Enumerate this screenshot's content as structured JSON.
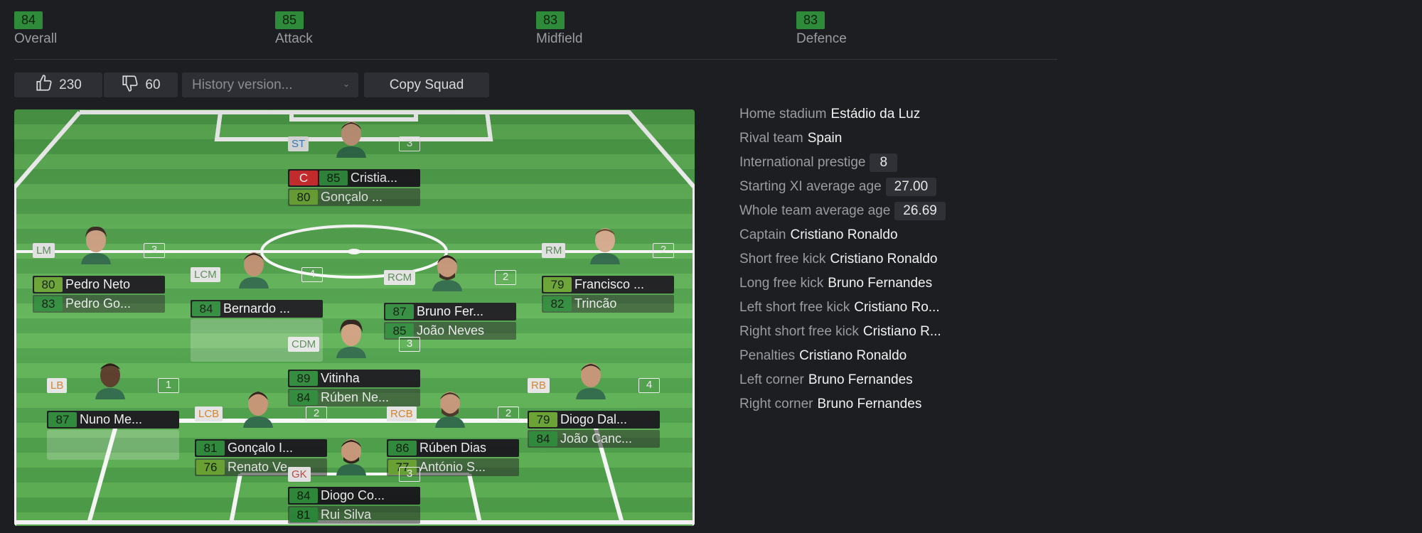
{
  "ratings": [
    {
      "value": "84",
      "label": "Overall"
    },
    {
      "value": "85",
      "label": "Attack"
    },
    {
      "value": "83",
      "label": "Midfield"
    },
    {
      "value": "83",
      "label": "Defence"
    }
  ],
  "toolbar": {
    "likes": "230",
    "dislikes": "60",
    "history_placeholder": "History version...",
    "copy_label": "Copy Squad"
  },
  "colors": {
    "ovr_high": "#2e8b3a",
    "ovr_mid": "#6aa532",
    "captain": "#d22b2b"
  },
  "players": [
    {
      "pos": "ST",
      "pos_group": "att",
      "num": "3",
      "captain": "C",
      "main_ovr": "85",
      "main_name": "Cristia...",
      "sub_ovr": "80",
      "sub_name": "Gonçalo ..."
    },
    {
      "pos": "LM",
      "pos_group": "mid",
      "num": "3",
      "main_ovr": "80",
      "main_name": "Pedro Neto",
      "sub_ovr": "83",
      "sub_name": "Pedro Go..."
    },
    {
      "pos": "LCM",
      "pos_group": "mid",
      "num": "4",
      "main_ovr": "84",
      "main_name": "Bernardo ...",
      "sub_ovr": "",
      "sub_name": ""
    },
    {
      "pos": "RCM",
      "pos_group": "mid",
      "num": "2",
      "main_ovr": "87",
      "main_name": "Bruno Fer...",
      "sub_ovr": "85",
      "sub_name": "João Neves"
    },
    {
      "pos": "RM",
      "pos_group": "mid",
      "num": "2",
      "main_ovr": "79",
      "main_name": "Francisco ...",
      "sub_ovr": "82",
      "sub_name": "Trincão"
    },
    {
      "pos": "CDM",
      "pos_group": "mid",
      "num": "3",
      "main_ovr": "89",
      "main_name": "Vitinha",
      "sub_ovr": "84",
      "sub_name": "Rúben Ne..."
    },
    {
      "pos": "LB",
      "pos_group": "def",
      "num": "1",
      "main_ovr": "87",
      "main_name": "Nuno Me...",
      "sub_ovr": "",
      "sub_name": ""
    },
    {
      "pos": "LCB",
      "pos_group": "def",
      "num": "2",
      "main_ovr": "81",
      "main_name": "Gonçalo I...",
      "sub_ovr": "76",
      "sub_name": "Renato Ve..."
    },
    {
      "pos": "RCB",
      "pos_group": "def",
      "num": "2",
      "main_ovr": "86",
      "main_name": "Rúben Dias",
      "sub_ovr": "77",
      "sub_name": "António S..."
    },
    {
      "pos": "RB",
      "pos_group": "def",
      "num": "4",
      "main_ovr": "79",
      "main_name": "Diogo Dal...",
      "sub_ovr": "84",
      "sub_name": "João Canc..."
    },
    {
      "pos": "GK",
      "pos_group": "gk",
      "num": "3",
      "main_ovr": "84",
      "main_name": "Diogo Co...",
      "sub_ovr": "81",
      "sub_name": "Rui Silva"
    }
  ],
  "info": [
    {
      "key": "Home stadium",
      "value": "Estádio da Luz",
      "boxed": false
    },
    {
      "key": "Rival team",
      "value": "Spain",
      "boxed": false
    },
    {
      "key": "International prestige",
      "value": "8",
      "boxed": true
    },
    {
      "key": "Starting XI average age",
      "value": "27.00",
      "boxed": true
    },
    {
      "key": "Whole team average age",
      "value": "26.69",
      "boxed": true
    },
    {
      "key": "Captain",
      "value": "Cristiano Ronaldo",
      "boxed": false
    },
    {
      "key": "Short free kick",
      "value": "Cristiano Ronaldo",
      "boxed": false
    },
    {
      "key": "Long free kick",
      "value": "Bruno Fernandes",
      "boxed": false
    },
    {
      "key": "Left short free kick",
      "value": "Cristiano Ro...",
      "boxed": false
    },
    {
      "key": "Right short free kick",
      "value": "Cristiano R...",
      "boxed": false
    },
    {
      "key": "Penalties",
      "value": "Cristiano Ronaldo",
      "boxed": false
    },
    {
      "key": "Left corner",
      "value": "Bruno Fernandes",
      "boxed": false
    },
    {
      "key": "Right corner",
      "value": "Bruno Fernandes",
      "boxed": false
    }
  ]
}
